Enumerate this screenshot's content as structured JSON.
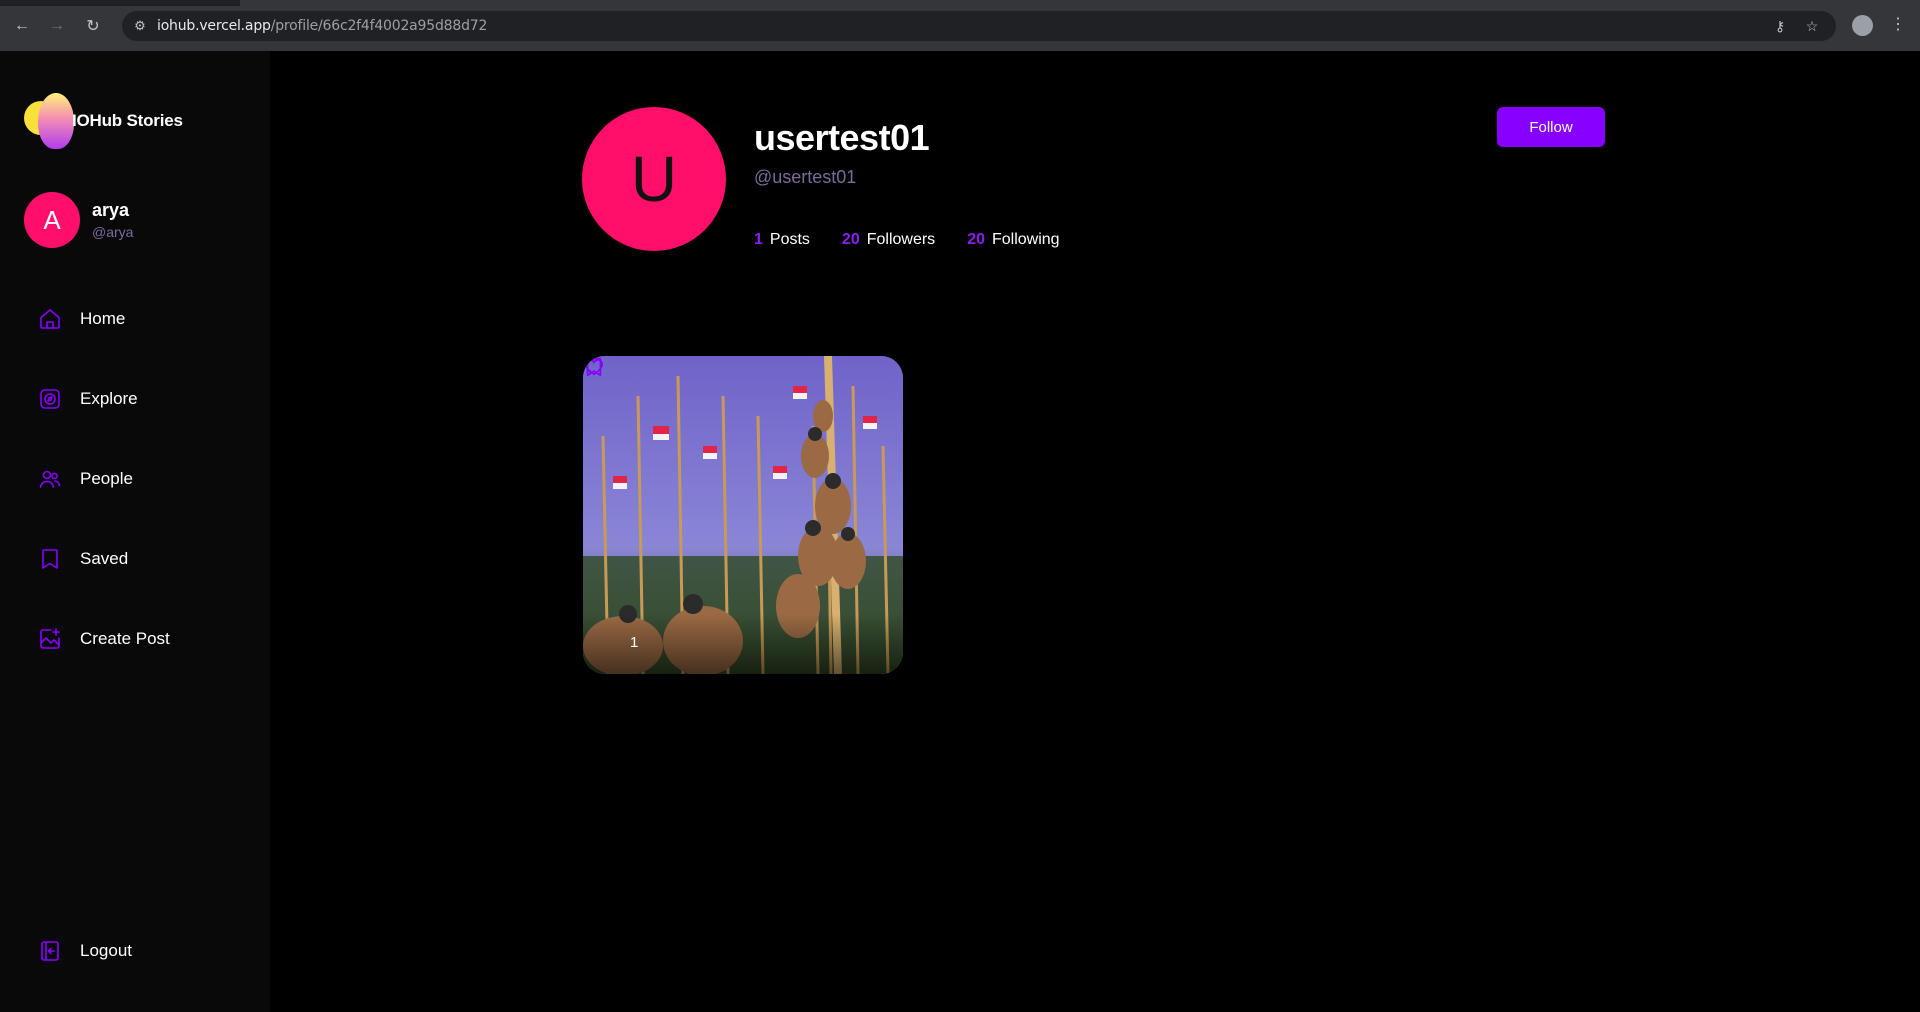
{
  "browser": {
    "url_host": "iohub.vercel.app",
    "url_path": "/profile/66c2f4f4002a95d88d72"
  },
  "app": {
    "name": "IOHub Stories"
  },
  "current_user": {
    "initial": "A",
    "name": "arya",
    "handle": "@arya"
  },
  "nav": {
    "items": [
      {
        "label": "Home",
        "icon": "home-icon"
      },
      {
        "label": "Explore",
        "icon": "explore-icon"
      },
      {
        "label": "People",
        "icon": "people-icon"
      },
      {
        "label": "Saved",
        "icon": "saved-icon"
      },
      {
        "label": "Create Post",
        "icon": "create-post-icon"
      }
    ],
    "logout_label": "Logout"
  },
  "profile": {
    "initial": "U",
    "name": "usertest01",
    "handle": "@usertest01",
    "follow_label": "Follow",
    "stats": [
      {
        "value": "1",
        "label": "Posts"
      },
      {
        "value": "20",
        "label": "Followers"
      },
      {
        "value": "20",
        "label": "Following"
      }
    ]
  },
  "posts": [
    {
      "likes": "1"
    }
  ],
  "colors": {
    "accent": "#8800ff",
    "avatar": "#ff0f69",
    "handle": "#7c6a99"
  }
}
